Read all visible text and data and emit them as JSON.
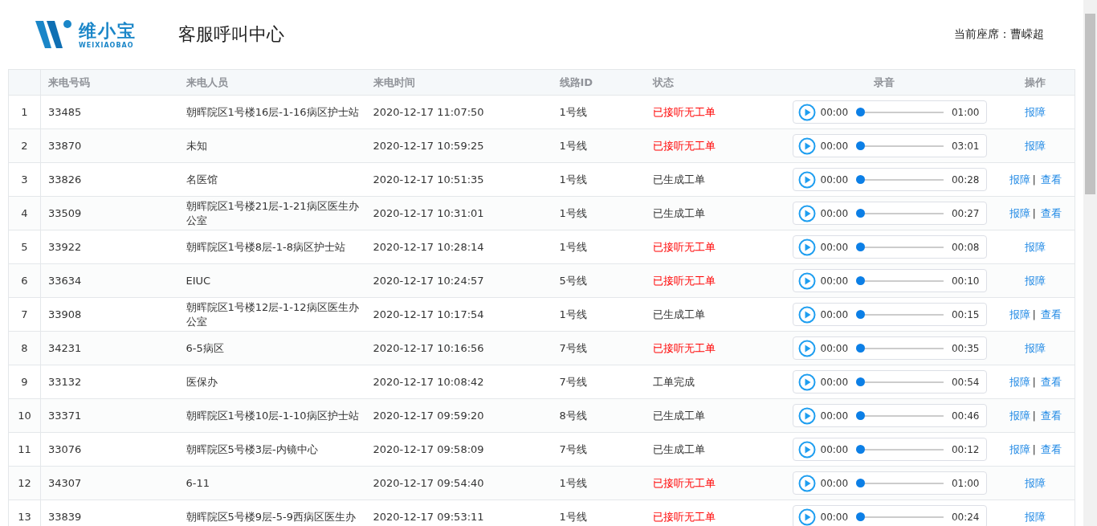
{
  "logo": {
    "name": "维小宝",
    "subtitle": "WEIXIAOBAO"
  },
  "title": "客服呼叫中心",
  "agent": {
    "label": "当前座席：",
    "name": "曹嵘超"
  },
  "table": {
    "columns": [
      "来电号码",
      "来电人员",
      "来电时间",
      "线路ID",
      "状态",
      "录音",
      "操作"
    ],
    "rows": [
      {
        "index": "1",
        "number": "33485",
        "caller": "朝晖院区1号楼16层-1-16病区护士站",
        "time": "2020-12-17 11:07:50",
        "line": "1号线",
        "status": "已接听无工单",
        "color": "#ff0000",
        "current": "00:00",
        "level": 0,
        "duration": "01:00",
        "actions": [
          "报障"
        ]
      },
      {
        "index": "2",
        "number": "33870",
        "caller": "未知",
        "time": "2020-12-17 10:59:25",
        "line": "1号线",
        "status": "已接听无工单",
        "color": "#ff0000",
        "current": "00:00",
        "level": 0,
        "duration": "03:01",
        "actions": [
          "报障"
        ]
      },
      {
        "index": "3",
        "number": "33826",
        "caller": "名医馆",
        "time": "2020-12-17 10:51:35",
        "line": "1号线",
        "status": "已生成工单",
        "color": "#333333",
        "current": "00:00",
        "level": 0,
        "duration": "00:28",
        "actions": [
          "报障",
          "查看"
        ],
        "separator": "|"
      },
      {
        "index": "4",
        "number": "33509",
        "caller": "朝晖院区1号楼21层-1-21病区医生办公室",
        "time": "2020-12-17 10:31:01",
        "line": "1号线",
        "status": "已生成工单",
        "color": "#333333",
        "current": "00:00",
        "level": 0,
        "duration": "00:27",
        "actions": [
          "报障",
          "查看"
        ],
        "separator": "|"
      },
      {
        "index": "5",
        "number": "33922",
        "caller": "朝晖院区1号楼8层-1-8病区护士站",
        "time": "2020-12-17 10:28:14",
        "line": "1号线",
        "status": "已接听无工单",
        "color": "#ff0000",
        "current": "00:00",
        "level": 0,
        "duration": "00:08",
        "actions": [
          "报障"
        ]
      },
      {
        "index": "6",
        "number": "33634",
        "caller": "EIUC",
        "time": "2020-12-17 10:24:57",
        "line": "5号线",
        "status": "已接听无工单",
        "color": "#ff0000",
        "current": "00:00",
        "level": 0,
        "duration": "00:10",
        "actions": [
          "报障"
        ]
      },
      {
        "index": "7",
        "number": "33908",
        "caller": "朝晖院区1号楼12层-1-12病区医生办公室",
        "time": "2020-12-17 10:17:54",
        "line": "1号线",
        "status": "已生成工单",
        "color": "#333333",
        "current": "00:00",
        "level": 0,
        "duration": "00:15",
        "actions": [
          "报障",
          "查看"
        ],
        "separator": "|"
      },
      {
        "index": "8",
        "number": "34231",
        "caller": "6-5病区",
        "time": "2020-12-17 10:16:56",
        "line": "7号线",
        "status": "已接听无工单",
        "color": "#ff0000",
        "current": "00:00",
        "level": 0,
        "duration": "00:35",
        "actions": [
          "报障"
        ]
      },
      {
        "index": "9",
        "number": "33132",
        "caller": "医保办",
        "time": "2020-12-17 10:08:42",
        "line": "7号线",
        "status": "工单完成",
        "color": "#333333",
        "current": "00:00",
        "level": 0,
        "duration": "00:54",
        "actions": [
          "报障",
          "查看"
        ],
        "separator": "|"
      },
      {
        "index": "10",
        "number": "33371",
        "caller": "朝晖院区1号楼10层-1-10病区护士站",
        "time": "2020-12-17 09:59:20",
        "line": "8号线",
        "status": "已生成工单",
        "color": "#333333",
        "current": "00:00",
        "level": 0,
        "duration": "00:46",
        "actions": [
          "报障",
          "查看"
        ],
        "separator": "|"
      },
      {
        "index": "11",
        "number": "33076",
        "caller": "朝晖院区5号楼3层-内镜中心",
        "time": "2020-12-17 09:58:09",
        "line": "7号线",
        "status": "已生成工单",
        "color": "#333333",
        "current": "00:00",
        "level": 0,
        "duration": "00:12",
        "actions": [
          "报障",
          "查看"
        ],
        "separator": "|"
      },
      {
        "index": "12",
        "number": "34307",
        "caller": "6-11",
        "time": "2020-12-17 09:54:40",
        "line": "1号线",
        "status": "已接听无工单",
        "color": "#ff0000",
        "current": "00:00",
        "level": 0,
        "duration": "01:00",
        "actions": [
          "报障"
        ]
      },
      {
        "index": "13",
        "number": "33839",
        "caller": "朝晖院区5号楼9层-5-9西病区医生办",
        "time": "2020-12-17 09:53:11",
        "line": "1号线",
        "status": "已接听无工单",
        "color": "#ff0000",
        "current": "00:00",
        "level": 0,
        "duration": "00:24",
        "actions": [
          "报障"
        ]
      }
    ]
  }
}
